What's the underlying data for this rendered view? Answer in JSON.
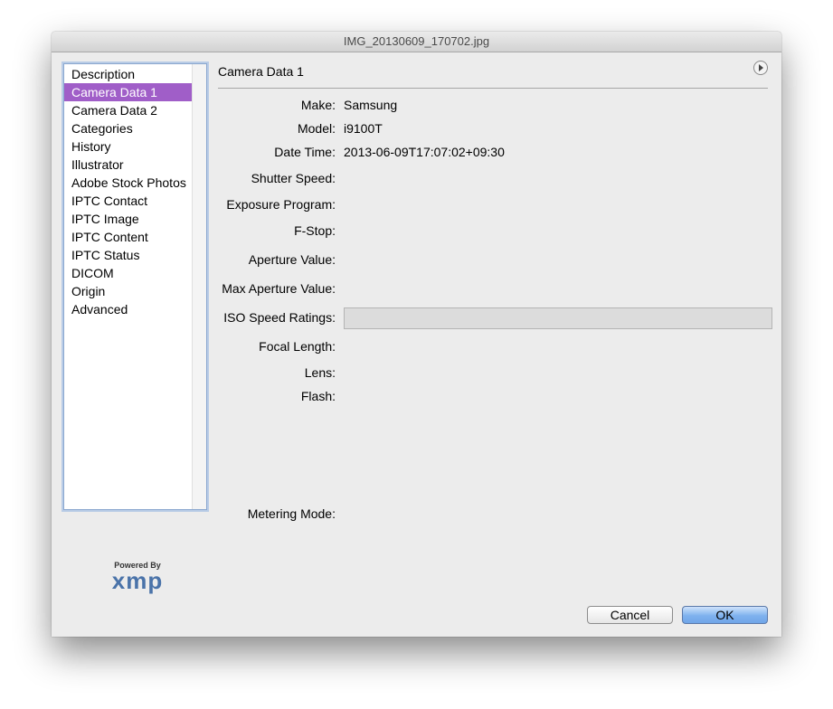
{
  "window": {
    "title": "IMG_20130609_170702.jpg"
  },
  "sidebar": {
    "items": [
      {
        "label": "Description"
      },
      {
        "label": "Camera Data 1",
        "selected": true
      },
      {
        "label": "Camera Data 2"
      },
      {
        "label": "Categories"
      },
      {
        "label": "History"
      },
      {
        "label": "Illustrator"
      },
      {
        "label": "Adobe Stock Photos"
      },
      {
        "label": "IPTC Contact"
      },
      {
        "label": "IPTC Image"
      },
      {
        "label": "IPTC Content"
      },
      {
        "label": "IPTC Status"
      },
      {
        "label": "DICOM"
      },
      {
        "label": "Origin"
      },
      {
        "label": "Advanced"
      }
    ]
  },
  "panel": {
    "title": "Camera Data 1",
    "fields": {
      "make": {
        "label": "Make:",
        "value": "Samsung"
      },
      "model": {
        "label": "Model:",
        "value": "i9100T"
      },
      "date_time": {
        "label": "Date Time:",
        "value": "2013-06-09T17:07:02+09:30"
      },
      "shutter_speed": {
        "label": "Shutter Speed:",
        "value": ""
      },
      "exposure_program": {
        "label": "Exposure Program:",
        "value": ""
      },
      "f_stop": {
        "label": "F-Stop:",
        "value": ""
      },
      "aperture_value": {
        "label": "Aperture Value:",
        "value": ""
      },
      "max_aperture_value": {
        "label": "Max Aperture Value:",
        "value": ""
      },
      "iso_speed_ratings": {
        "label": "ISO Speed Ratings:",
        "value": ""
      },
      "focal_length": {
        "label": "Focal Length:",
        "value": ""
      },
      "lens": {
        "label": "Lens:",
        "value": ""
      },
      "flash": {
        "label": "Flash:",
        "value": ""
      },
      "metering_mode": {
        "label": "Metering Mode:",
        "value": ""
      }
    }
  },
  "branding": {
    "powered_by": "Powered By",
    "logo_text": "xmp"
  },
  "buttons": {
    "cancel": "Cancel",
    "ok": "OK"
  },
  "colors": {
    "selection": "#a05ec8",
    "default_button": "#7fb2ee"
  }
}
